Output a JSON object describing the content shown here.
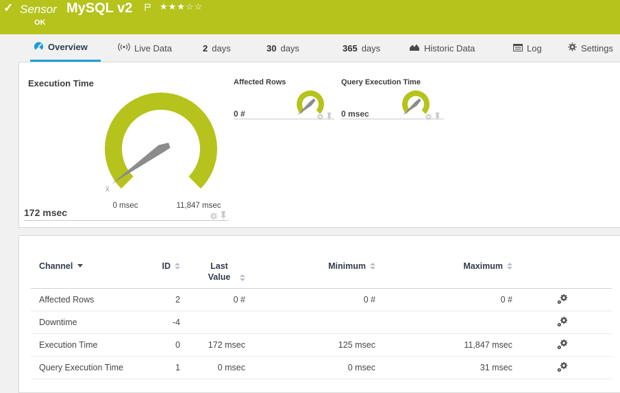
{
  "colors": {
    "brand_green": "#b5c31c",
    "accent_blue": "#1e9dd8"
  },
  "header": {
    "check": "✓",
    "kind": "Sensor",
    "name": "MySQL v2",
    "status": "OK",
    "stars": "★★★☆☆",
    "stars_filled": 3,
    "stars_total": 5
  },
  "tabs": {
    "overview": "Overview",
    "live_data": "Live Data",
    "d2_num": "2",
    "d2_label": "days",
    "d30_num": "30",
    "d30_label": "days",
    "d365_num": "365",
    "d365_label": "days",
    "historic": "Historic Data",
    "log": "Log",
    "settings": "Settings"
  },
  "gauges": {
    "primary": {
      "title": "Execution Time",
      "value": "172 msec",
      "min": "0 msec",
      "max": "11,847 msec",
      "mean_marker": "x̄"
    },
    "affected_rows": {
      "title": "Affected Rows",
      "value": "0 #"
    },
    "query_exec": {
      "title": "Query Execution Time",
      "value": "0 msec"
    }
  },
  "table": {
    "headers": {
      "channel": "Channel",
      "id": "ID",
      "last": "Last Value",
      "min": "Minimum",
      "max": "Maximum"
    },
    "rows": [
      {
        "channel": "Affected Rows",
        "id": "2",
        "last": "0 #",
        "min": "0 #",
        "max": "0 #"
      },
      {
        "channel": "Downtime",
        "id": "-4",
        "last": "",
        "min": "",
        "max": ""
      },
      {
        "channel": "Execution Time",
        "id": "0",
        "last": "172 msec",
        "min": "125 msec",
        "max": "11,847 msec"
      },
      {
        "channel": "Query Execution Time",
        "id": "1",
        "last": "0 msec",
        "min": "0 msec",
        "max": "31 msec"
      }
    ]
  }
}
